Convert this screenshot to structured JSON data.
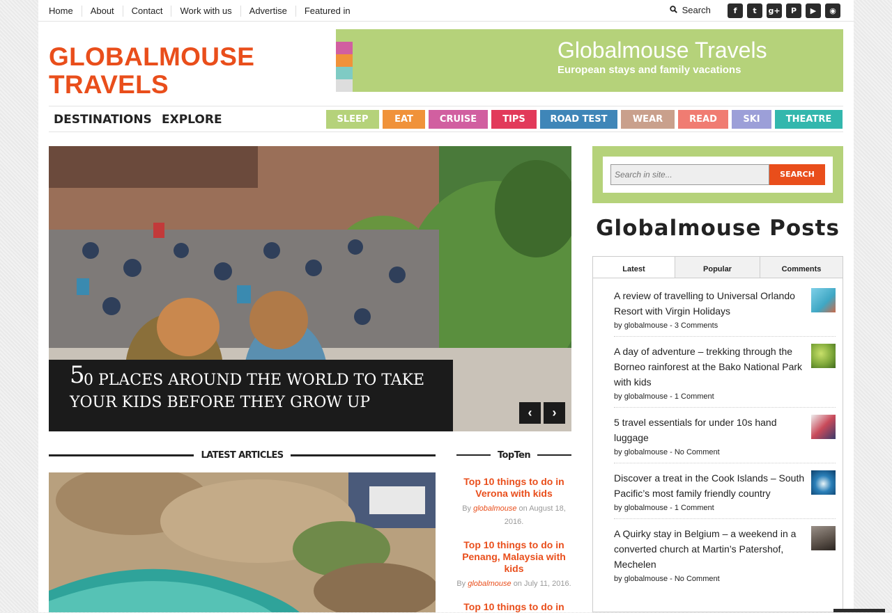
{
  "topnav": {
    "items": [
      "Home",
      "About",
      "Contact",
      "Work with us",
      "Advertise",
      "Featured in"
    ]
  },
  "topbar": {
    "search_label": "Search",
    "search_icon": "search-icon",
    "social": [
      {
        "icon": "facebook-icon",
        "glyph": "f"
      },
      {
        "icon": "twitter-icon",
        "glyph": "t"
      },
      {
        "icon": "google-plus-icon",
        "glyph": "g+"
      },
      {
        "icon": "pinterest-icon",
        "glyph": "P"
      },
      {
        "icon": "youtube-icon",
        "glyph": "▶"
      },
      {
        "icon": "rss-icon",
        "glyph": "◉"
      }
    ]
  },
  "header": {
    "logo_line1": "GLOBALMOUSE",
    "logo_line2": "TRAVELS",
    "logo_color": "#e94e1b",
    "banner_title": "Globalmouse Travels",
    "banner_subtitle": "European stays and family vacations",
    "banner_color": "#b5d27a",
    "banner_squares": [
      "#d15fa0",
      "#f0923a",
      "#7fcbc4",
      "#dddddd"
    ]
  },
  "mainnav": {
    "primary": [
      "DESTINATIONS",
      "EXPLORE"
    ],
    "categories": [
      {
        "label": "SLEEP",
        "color": "#b5d27a"
      },
      {
        "label": "EAT",
        "color": "#f0923a"
      },
      {
        "label": "CRUISE",
        "color": "#d15fa0"
      },
      {
        "label": "TIPS",
        "color": "#e23a5a"
      },
      {
        "label": "ROAD TEST",
        "color": "#3f86b8"
      },
      {
        "label": "WEAR",
        "color": "#c9a08c"
      },
      {
        "label": "READ",
        "color": "#f07c72"
      },
      {
        "label": "SKI",
        "color": "#9c9fd8"
      },
      {
        "label": "THEATRE",
        "color": "#33b7ad"
      }
    ]
  },
  "hero": {
    "number": "5",
    "title": "0 PLACES AROUND THE WORLD TO TAKE YOUR KIDS BEFORE THEY GROW UP",
    "prev": "‹",
    "next": "›"
  },
  "latest": {
    "heading": "LATEST ARTICLES"
  },
  "topten": {
    "heading": "TopTen",
    "items": [
      {
        "title": "Top 10 things to do in Verona with kids",
        "by": "By",
        "author": "globalmouse",
        "date": "on August 18, 2016."
      },
      {
        "title": "Top 10 things to do in Penang, Malaysia with kids",
        "by": "By",
        "author": "globalmouse",
        "date": "on July 11, 2016."
      },
      {
        "title": "Top 10 things to do in"
      }
    ]
  },
  "sidebar": {
    "search_placeholder": "Search in site...",
    "search_button": "SEARCH",
    "posts_title": "Globalmouse Posts",
    "tabs": [
      "Latest",
      "Popular",
      "Comments"
    ],
    "posts": [
      {
        "title": "A review of travelling to Universal Orlando Resort with Virgin Holidays",
        "by": "by",
        "author": "globalmouse",
        "dash": "-",
        "comments": "3 Comments",
        "thumb": "#3fa7c4"
      },
      {
        "title": "A day of adventure – trekking through the Borneo rainforest at the Bako National Park with kids",
        "by": "by",
        "author": "globalmouse",
        "dash": "-",
        "comments": "1 Comment",
        "thumb": "#7fa83a"
      },
      {
        "title": "5 travel essentials for under 10s hand luggage",
        "by": "by",
        "author": "globalmouse",
        "dash": "-",
        "comments": "No Comment",
        "thumb": "#c94a5a"
      },
      {
        "title": "Discover a treat in the Cook Islands – South Pacific’s most family friendly country",
        "by": "by",
        "author": "globalmouse",
        "dash": "-",
        "comments": "1 Comment",
        "thumb": "#2a7fb8"
      },
      {
        "title": "A Quirky stay in Belgium – a weekend in a converted church at Martin’s Patershof, Mechelen",
        "by": "by",
        "author": "globalmouse",
        "dash": "-",
        "comments": "No Comment",
        "thumb": "#5a5048"
      }
    ]
  }
}
